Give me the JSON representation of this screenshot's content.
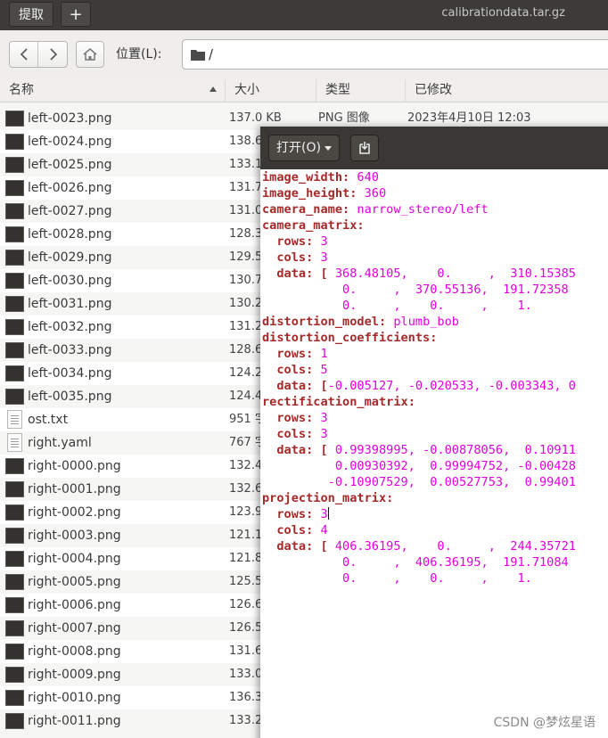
{
  "file_manager": {
    "extract_label": "提取",
    "new_tab_label": "+",
    "window_title": "calibrationdata.tar.gz",
    "location_label": "位置(L):",
    "path": "/",
    "columns": {
      "name": "名称",
      "size": "大小",
      "type": "类型",
      "modified": "已修改"
    },
    "files": [
      {
        "name": "left-0023.png",
        "size": "137.0 KB",
        "type": "PNG 图像",
        "modified": "2023年4月10日 12:03",
        "kind": "image"
      },
      {
        "name": "left-0024.png",
        "size": "138.6",
        "type": "",
        "modified": "",
        "kind": "image"
      },
      {
        "name": "left-0025.png",
        "size": "133.1",
        "type": "",
        "modified": "",
        "kind": "image"
      },
      {
        "name": "left-0026.png",
        "size": "131.7",
        "type": "",
        "modified": "",
        "kind": "image"
      },
      {
        "name": "left-0027.png",
        "size": "131.0",
        "type": "",
        "modified": "",
        "kind": "image"
      },
      {
        "name": "left-0028.png",
        "size": "128.3",
        "type": "",
        "modified": "",
        "kind": "image"
      },
      {
        "name": "left-0029.png",
        "size": "129.5",
        "type": "",
        "modified": "",
        "kind": "image"
      },
      {
        "name": "left-0030.png",
        "size": "130.7",
        "type": "",
        "modified": "",
        "kind": "image"
      },
      {
        "name": "left-0031.png",
        "size": "130.2",
        "type": "",
        "modified": "",
        "kind": "image"
      },
      {
        "name": "left-0032.png",
        "size": "131.2",
        "type": "",
        "modified": "",
        "kind": "image"
      },
      {
        "name": "left-0033.png",
        "size": "128.6",
        "type": "",
        "modified": "",
        "kind": "image"
      },
      {
        "name": "left-0034.png",
        "size": "124.2",
        "type": "",
        "modified": "",
        "kind": "image"
      },
      {
        "name": "left-0035.png",
        "size": "124.4",
        "type": "",
        "modified": "",
        "kind": "image"
      },
      {
        "name": "ost.txt",
        "size": "951 字",
        "type": "",
        "modified": "",
        "kind": "text"
      },
      {
        "name": "right.yaml",
        "size": "767 字",
        "type": "",
        "modified": "",
        "kind": "text"
      },
      {
        "name": "right-0000.png",
        "size": "132.4",
        "type": "",
        "modified": "",
        "kind": "image"
      },
      {
        "name": "right-0001.png",
        "size": "132.6",
        "type": "",
        "modified": "",
        "kind": "image"
      },
      {
        "name": "right-0002.png",
        "size": "123.9",
        "type": "",
        "modified": "",
        "kind": "image"
      },
      {
        "name": "right-0003.png",
        "size": "121.1",
        "type": "",
        "modified": "",
        "kind": "image"
      },
      {
        "name": "right-0004.png",
        "size": "121.8",
        "type": "",
        "modified": "",
        "kind": "image"
      },
      {
        "name": "right-0005.png",
        "size": "125.5",
        "type": "",
        "modified": "",
        "kind": "image"
      },
      {
        "name": "right-0006.png",
        "size": "126.6",
        "type": "",
        "modified": "",
        "kind": "image"
      },
      {
        "name": "right-0007.png",
        "size": "126.5",
        "type": "",
        "modified": "",
        "kind": "image"
      },
      {
        "name": "right-0008.png",
        "size": "131.6",
        "type": "",
        "modified": "",
        "kind": "image"
      },
      {
        "name": "right-0009.png",
        "size": "133.0",
        "type": "",
        "modified": "",
        "kind": "image"
      },
      {
        "name": "right-0010.png",
        "size": "136.3",
        "type": "",
        "modified": "",
        "kind": "image"
      },
      {
        "name": "right-0011.png",
        "size": "133.2",
        "type": "",
        "modified": "",
        "kind": "image"
      }
    ]
  },
  "editor": {
    "open_label": "打开(O)",
    "lines": [
      [
        {
          "t": "image_width",
          "c": "k"
        },
        {
          "t": ": ",
          "c": "k"
        },
        {
          "t": "640",
          "c": "v"
        }
      ],
      [
        {
          "t": "image_height",
          "c": "k"
        },
        {
          "t": ": ",
          "c": "k"
        },
        {
          "t": "360",
          "c": "v"
        }
      ],
      [
        {
          "t": "camera_name",
          "c": "k"
        },
        {
          "t": ": ",
          "c": "k"
        },
        {
          "t": "narrow_stereo/left",
          "c": "v"
        }
      ],
      [
        {
          "t": "camera_matrix",
          "c": "k"
        },
        {
          "t": ":",
          "c": "k"
        }
      ],
      [
        {
          "t": "  rows",
          "c": "k"
        },
        {
          "t": ": ",
          "c": "k"
        },
        {
          "t": "3",
          "c": "v"
        }
      ],
      [
        {
          "t": "  cols",
          "c": "k"
        },
        {
          "t": ": ",
          "c": "k"
        },
        {
          "t": "3",
          "c": "v"
        }
      ],
      [
        {
          "t": "  data",
          "c": "k"
        },
        {
          "t": ": [ ",
          "c": "k"
        },
        {
          "t": "368.48105,    0.     ,  310.15385",
          "c": "v"
        }
      ],
      [
        {
          "t": "           0.     ,  370.55136,  191.72358",
          "c": "v"
        }
      ],
      [
        {
          "t": "           0.     ,    0.     ,    1.",
          "c": "v"
        }
      ],
      [
        {
          "t": "distortion_model",
          "c": "k"
        },
        {
          "t": ": ",
          "c": "k"
        },
        {
          "t": "plumb_bob",
          "c": "v"
        }
      ],
      [
        {
          "t": "distortion_coefficients",
          "c": "k"
        },
        {
          "t": ":",
          "c": "k"
        }
      ],
      [
        {
          "t": "  rows",
          "c": "k"
        },
        {
          "t": ": ",
          "c": "k"
        },
        {
          "t": "1",
          "c": "v"
        }
      ],
      [
        {
          "t": "  cols",
          "c": "k"
        },
        {
          "t": ": ",
          "c": "k"
        },
        {
          "t": "5",
          "c": "v"
        }
      ],
      [
        {
          "t": "  data",
          "c": "k"
        },
        {
          "t": ": [",
          "c": "k"
        },
        {
          "t": "-0.005127, -0.020533, -0.003343, 0",
          "c": "v"
        }
      ],
      [
        {
          "t": "rectification_matrix",
          "c": "k"
        },
        {
          "t": ":",
          "c": "k"
        }
      ],
      [
        {
          "t": "  rows",
          "c": "k"
        },
        {
          "t": ": ",
          "c": "k"
        },
        {
          "t": "3",
          "c": "v"
        }
      ],
      [
        {
          "t": "  cols",
          "c": "k"
        },
        {
          "t": ": ",
          "c": "k"
        },
        {
          "t": "3",
          "c": "v"
        }
      ],
      [
        {
          "t": "  data",
          "c": "k"
        },
        {
          "t": ": [ ",
          "c": "k"
        },
        {
          "t": "0.99398995, -0.00878056,  0.10911",
          "c": "v"
        }
      ],
      [
        {
          "t": "          0.00930392,  0.99994752, -0.00428",
          "c": "v"
        }
      ],
      [
        {
          "t": "         -0.10907529,  0.00527753,  0.99401",
          "c": "v"
        }
      ],
      [
        {
          "t": "projection_matrix",
          "c": "k"
        },
        {
          "t": ":",
          "c": "k"
        }
      ],
      [
        {
          "t": "  rows",
          "c": "k"
        },
        {
          "t": ": ",
          "c": "k"
        },
        {
          "t": "3",
          "c": "v"
        },
        {
          "t": "",
          "c": "cursor"
        }
      ],
      [
        {
          "t": "  cols",
          "c": "k"
        },
        {
          "t": ": ",
          "c": "k"
        },
        {
          "t": "4",
          "c": "v"
        }
      ],
      [
        {
          "t": "  data",
          "c": "k"
        },
        {
          "t": ": [ ",
          "c": "k"
        },
        {
          "t": "406.36195,    0.     ,  244.35721",
          "c": "v"
        }
      ],
      [
        {
          "t": "           0.     ,  406.36195,  191.71084",
          "c": "v"
        }
      ],
      [
        {
          "t": "           0.     ,    0.     ,    1.",
          "c": "v"
        }
      ]
    ]
  },
  "watermark": "CSDN @梦炫星语",
  "colors": {
    "key": "#a52a2a",
    "value": "#e000e0",
    "titlebar": "#3c3b37"
  }
}
